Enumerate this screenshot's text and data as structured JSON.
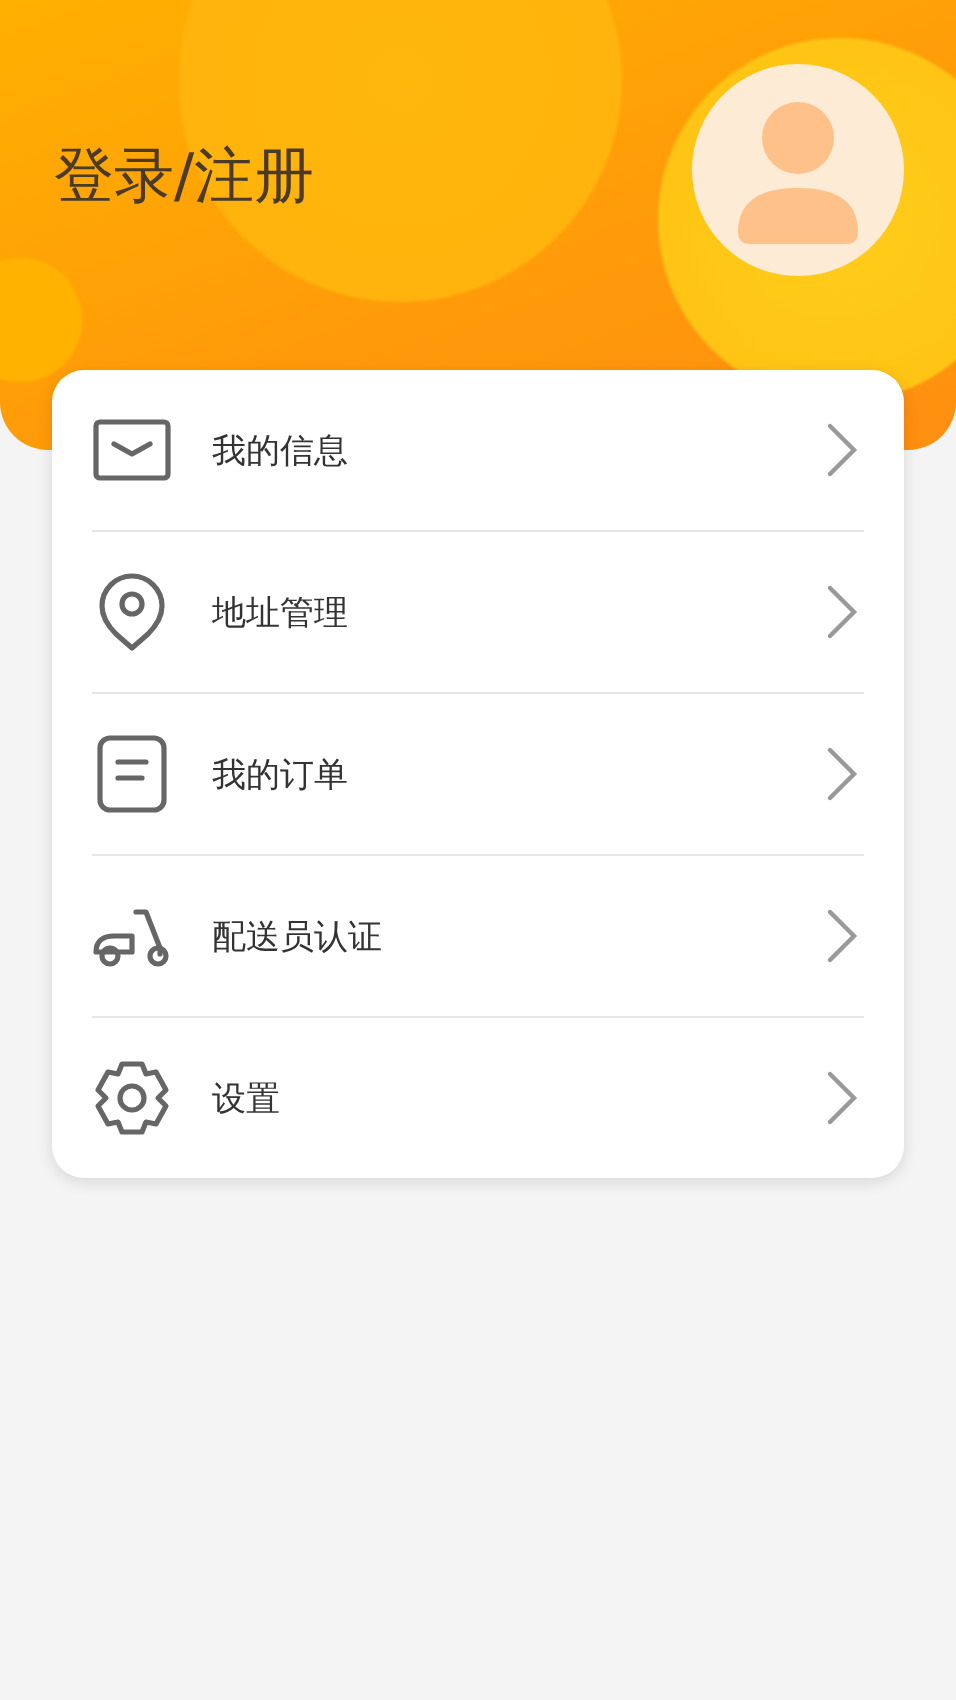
{
  "header": {
    "title": "登录/注册"
  },
  "menu": [
    {
      "kind": "mail",
      "label": "我的信息"
    },
    {
      "kind": "location",
      "label": "地址管理"
    },
    {
      "kind": "order",
      "label": "我的订单"
    },
    {
      "kind": "scooter",
      "label": "配送员认证"
    },
    {
      "kind": "settings",
      "label": "设置"
    }
  ]
}
